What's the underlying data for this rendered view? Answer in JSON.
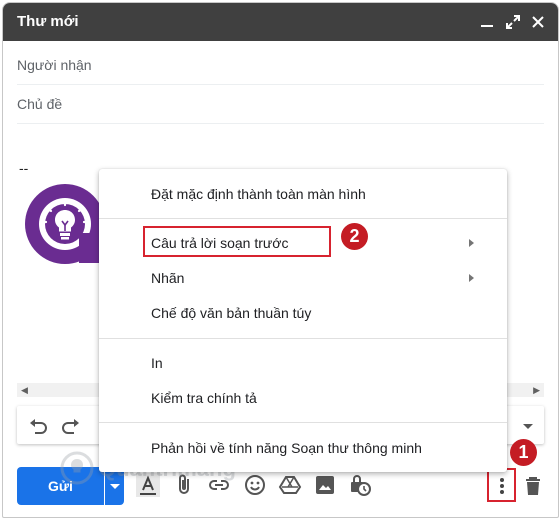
{
  "window": {
    "title": "Thư mới",
    "controls": [
      "minimize-icon",
      "expand-icon",
      "close-icon"
    ]
  },
  "fields": {
    "recipients_placeholder": "Người nhận",
    "subject_placeholder": "Chủ đề"
  },
  "body": {
    "signature_dash": "--"
  },
  "menu": {
    "items": [
      {
        "label": "Đặt mặc định thành toàn màn hình",
        "submenu": false
      },
      {
        "label": "Câu trả lời soạn trước",
        "submenu": true,
        "highlighted": true
      },
      {
        "label": "Nhãn",
        "submenu": true
      },
      {
        "label": "Chế độ văn bản thuần túy",
        "submenu": false
      },
      {
        "label": "In",
        "submenu": false
      },
      {
        "label": "Kiểm tra chính tả",
        "submenu": false
      },
      {
        "label": "Phản hồi về tính năng Soạn thư thông minh",
        "submenu": false
      }
    ]
  },
  "bottom": {
    "send_label": "Gửi",
    "tools": [
      "text-format-icon",
      "attach-icon",
      "link-icon",
      "emoji-icon",
      "drive-icon",
      "photo-icon",
      "schedule-lock-icon"
    ],
    "more_options_icon": "more-vert-icon",
    "trash_icon": "trash-icon"
  },
  "annotations": {
    "badge_1": "1",
    "badge_2": "2",
    "highlight_color": "#d7232f",
    "badge_color": "#c41c24"
  },
  "colors": {
    "titlebar": "#404040",
    "send_button": "#1a73e8",
    "logo_purple": "#6a2c91"
  }
}
